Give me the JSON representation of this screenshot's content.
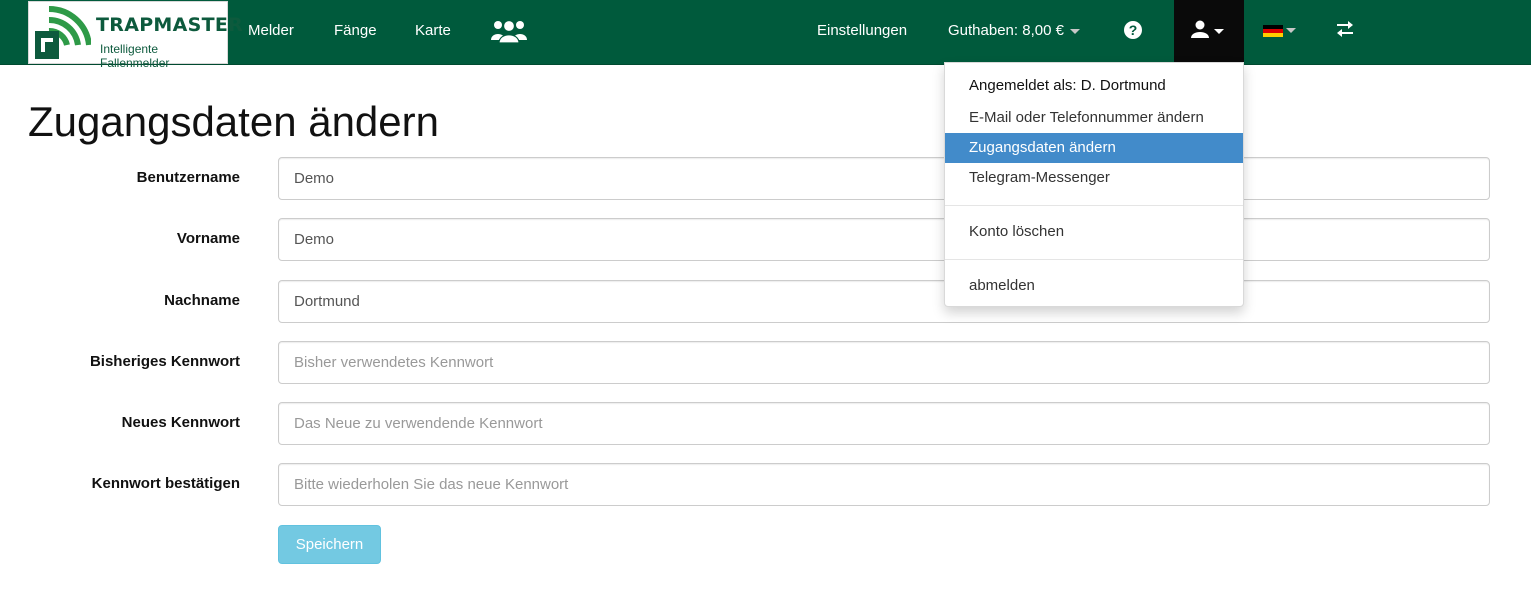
{
  "brand": {
    "name": "TRAPMASTER",
    "tagline": "Intelligente Fallenmelder"
  },
  "nav": {
    "left": [
      "Melder",
      "Fänge",
      "Karte"
    ],
    "team_icon": "users-icon",
    "settings": "Einstellungen",
    "credit": "Guthaben: 8,00 €",
    "help_icon": "question-circle-icon",
    "help_symbol": "?",
    "user_icon": "user-icon",
    "language_icon": "flag-de-icon",
    "switch_icon": "swap-arrows-icon"
  },
  "page": {
    "title": "Zugangsdaten ändern"
  },
  "form": {
    "fields": [
      {
        "label": "Benutzername",
        "value": "Demo",
        "placeholder": ""
      },
      {
        "label": "Vorname",
        "value": "Demo",
        "placeholder": ""
      },
      {
        "label": "Nachname",
        "value": "Dortmund",
        "placeholder": ""
      },
      {
        "label": "Bisheriges Kennwort",
        "value": "",
        "placeholder": "Bisher verwendetes Kennwort"
      },
      {
        "label": "Neues Kennwort",
        "value": "",
        "placeholder": "Das Neue zu verwendende Kennwort"
      },
      {
        "label": "Kennwort bestätigen",
        "value": "",
        "placeholder": "Bitte wiederholen Sie das neue Kennwort"
      }
    ],
    "save_label": "Speichern"
  },
  "user_menu": {
    "signed_in": "Angemeldet als: D. Dortmund",
    "items": [
      "E-Mail oder Telefonnummer ändern",
      "Zugangsdaten ändern",
      "Telegram-Messenger"
    ],
    "active_index": 1,
    "delete_account": "Konto löschen",
    "logout": "abmelden"
  },
  "colors": {
    "navbar": "#005a3c",
    "active_item": "#428bca",
    "save_button": "#5bc0de",
    "flag": [
      "#000000",
      "#dd0000",
      "#ffce00"
    ]
  }
}
